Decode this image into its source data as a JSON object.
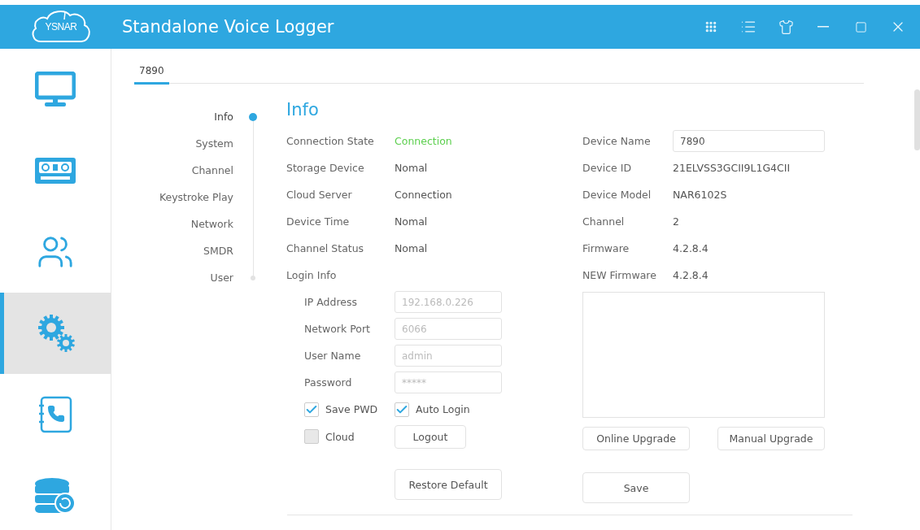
{
  "window": {
    "logo": "YSNAR",
    "title": "Standalone Voice Logger",
    "controls": [
      {
        "kind": "apps"
      },
      {
        "kind": "list"
      },
      {
        "kind": "skin"
      },
      {
        "kind": "minimize"
      },
      {
        "kind": "maximize"
      },
      {
        "kind": "close"
      }
    ]
  },
  "sidebar": {
    "items": [
      {
        "kind": "monitor",
        "selected": false
      },
      {
        "kind": "cassette",
        "selected": false
      },
      {
        "kind": "users",
        "selected": false
      },
      {
        "kind": "gears",
        "selected": true
      },
      {
        "kind": "phonebook",
        "selected": false
      },
      {
        "kind": "database",
        "selected": false
      }
    ]
  },
  "tabs": [
    {
      "label": "7890",
      "selected": true
    }
  ],
  "sections": [
    {
      "label": "Info",
      "selected": true
    },
    {
      "label": "System",
      "selected": false
    },
    {
      "label": "Channel",
      "selected": false
    },
    {
      "label": "Keystroke Play",
      "selected": false
    },
    {
      "label": "Network",
      "selected": false
    },
    {
      "label": "SMDR",
      "selected": false
    },
    {
      "label": "User",
      "selected": false
    }
  ],
  "info": {
    "title": "Info",
    "status": [
      {
        "label": "Connection State",
        "value": "Connection",
        "color": "#5ccf4e"
      },
      {
        "label": "Storage Device",
        "value": "Nomal",
        "color": "#555555"
      },
      {
        "label": "Cloud Server",
        "value": "Connection",
        "color": "#555555"
      },
      {
        "label": "Device Time",
        "value": "Nomal",
        "color": "#555555"
      },
      {
        "label": "Channel Status",
        "value": "Nomal",
        "color": "#555555"
      }
    ],
    "login": {
      "title": "Login Info",
      "fields": [
        {
          "label": "IP Address",
          "value": "192.168.0.226",
          "disabled": true
        },
        {
          "label": "Network Port",
          "value": "6066",
          "disabled": true
        },
        {
          "label": "User Name",
          "value": "admin",
          "disabled": true
        },
        {
          "label": "Password",
          "value": "*****",
          "disabled": true
        }
      ],
      "options": [
        {
          "label": "Save PWD",
          "checked": true
        },
        {
          "label": "Auto Login",
          "checked": true
        },
        {
          "label": "Cloud",
          "checked": false
        }
      ],
      "logout": "Logout"
    },
    "restore": "Restore Default",
    "device": {
      "name_label": "Device Name",
      "name_value": "7890",
      "rows": [
        {
          "label": "Device ID",
          "value": "21ELVSS3GCII9L1G4CII"
        },
        {
          "label": "Device Model",
          "value": "NAR6102S"
        },
        {
          "label": "Channel",
          "value": "2"
        },
        {
          "label": "Firmware",
          "value": "4.2.8.4"
        },
        {
          "label": "NEW Firmware",
          "value": "4.2.8.4"
        }
      ]
    },
    "upgrade_buttons": [
      "Online Upgrade",
      "Manual Upgrade"
    ],
    "save": "Save"
  }
}
